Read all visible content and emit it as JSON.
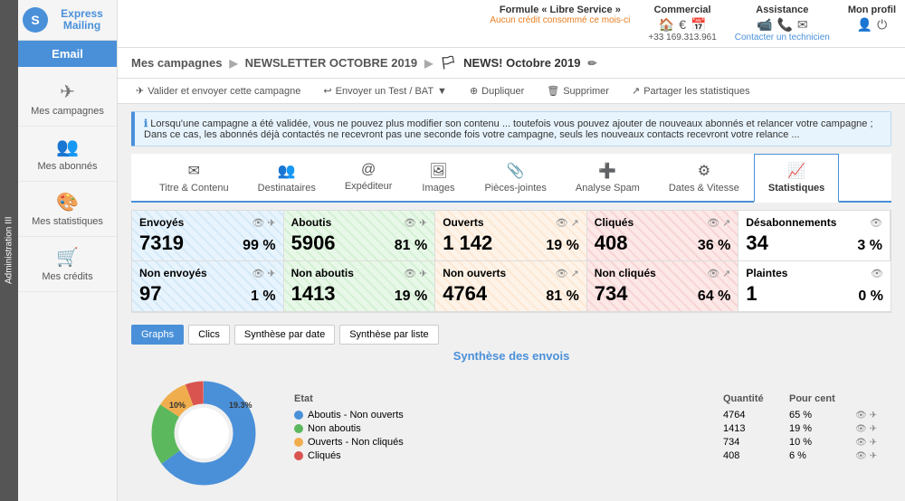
{
  "adminBar": {
    "label": "Administration III"
  },
  "sidebar": {
    "logo": {
      "icon": "S",
      "name": "Express",
      "highlight": "M",
      "suffix": "ailing"
    },
    "emailBtn": "Email",
    "items": [
      {
        "id": "campagnes",
        "label": "Mes campagnes",
        "icon": "✈"
      },
      {
        "id": "abonnes",
        "label": "Mes abonnés",
        "icon": "👥"
      },
      {
        "id": "statistiques",
        "label": "Mes statistiques",
        "icon": "🎨"
      },
      {
        "id": "credits",
        "label": "Mes crédits",
        "icon": "🛒"
      }
    ]
  },
  "header": {
    "formule": {
      "label": "Formule « Libre Service »",
      "link": "Aucun crédit consommé ce mois-ci"
    },
    "commercial": {
      "label": "Commercial",
      "phone": "+33 169.313.961"
    },
    "assistance": {
      "label": "Assistance",
      "link": "Contacter un technicien"
    },
    "profil": {
      "label": "Mon profil"
    }
  },
  "breadcrumb": {
    "items": [
      "Mes campagnes",
      "NEWSLETTER OCTOBRE 2019",
      "NEWS! Octobre 2019"
    ]
  },
  "actions": [
    {
      "id": "valider",
      "label": "Valider et envoyer cette campagne",
      "icon": "✈"
    },
    {
      "id": "test",
      "label": "Envoyer un Test / BAT",
      "icon": "↩",
      "dropdown": true
    },
    {
      "id": "dupliquer",
      "label": "Dupliquer",
      "icon": "⊕"
    },
    {
      "id": "supprimer",
      "label": "Supprimer",
      "icon": "🗑"
    },
    {
      "id": "partager",
      "label": "Partager les statistiques",
      "icon": "↗"
    }
  ],
  "infoBar": {
    "text": "Lorsqu'une campagne a été validée, vous ne pouvez plus modifier son contenu ... toutefois vous pouvez ajouter de nouveaux abonnés et relancer votre campagne ; Dans ce cas, les abonnés déjà contactés ne recevront pas une seconde fois votre campagne, seuls les nouveaux contacts recevront votre relance ..."
  },
  "tabs": [
    {
      "id": "titre",
      "label": "Titre & Contenu",
      "icon": "✉"
    },
    {
      "id": "destinataires",
      "label": "Destinataires",
      "icon": "👥"
    },
    {
      "id": "expediteur",
      "label": "Expéditeur",
      "icon": "@"
    },
    {
      "id": "images",
      "label": "Images",
      "icon": "🖼"
    },
    {
      "id": "pieces",
      "label": "Pièces-jointes",
      "icon": "📎"
    },
    {
      "id": "spam",
      "label": "Analyse Spam",
      "icon": "➕"
    },
    {
      "id": "dates",
      "label": "Dates & Vitesse",
      "icon": "⚙"
    },
    {
      "id": "stats",
      "label": "Statistiques",
      "icon": "📈",
      "active": true
    }
  ],
  "statsGrid": {
    "row1": [
      {
        "id": "envoyes",
        "title": "Envoyés",
        "value": "7319",
        "percent": "99 %",
        "color": "blue"
      },
      {
        "id": "aboutis",
        "title": "Aboutis",
        "value": "5906",
        "percent": "81 %",
        "color": "green"
      },
      {
        "id": "ouverts",
        "title": "Ouverts",
        "value": "1 142",
        "percent": "19 %",
        "color": "orange"
      },
      {
        "id": "cliques",
        "title": "Cliqués",
        "value": "408",
        "percent": "36 %",
        "color": "red"
      },
      {
        "id": "desabo",
        "title": "Désabonnements",
        "value": "34",
        "percent": "3 %",
        "color": "white"
      }
    ],
    "row2": [
      {
        "id": "nonenvoyes",
        "title": "Non envoyés",
        "value": "97",
        "percent": "1 %",
        "color": "blue"
      },
      {
        "id": "nonaboutis",
        "title": "Non aboutis",
        "value": "1413",
        "percent": "19 %",
        "color": "green"
      },
      {
        "id": "nonouverts",
        "title": "Non ouverts",
        "value": "4764",
        "percent": "81 %",
        "color": "orange"
      },
      {
        "id": "noncliques",
        "title": "Non cliqués",
        "value": "734",
        "percent": "64 %",
        "color": "red"
      },
      {
        "id": "plaintes",
        "title": "Plaintes",
        "value": "1",
        "percent": "0 %",
        "color": "white"
      }
    ]
  },
  "subButtons": [
    "Graphs",
    "Clics",
    "Synthèse par date",
    "Synthèse par liste"
  ],
  "synthese": {
    "title": "Synthèse des envois",
    "chartData": [
      {
        "label": "65.1%",
        "color": "#4a90d9",
        "percent": 65.1
      },
      {
        "label": "19.3%",
        "color": "#5cb85c",
        "percent": 19.3
      },
      {
        "label": "10%",
        "color": "#f0ad4e",
        "percent": 10
      },
      {
        "label": "",
        "color": "#d9534f",
        "percent": 5.6
      }
    ],
    "legend": {
      "headers": [
        "Etat",
        "Quantité",
        "Pour cent"
      ],
      "rows": [
        {
          "label": "Aboutis - Non ouverts",
          "color": "#4a90d9",
          "qty": "4764",
          "pct": "65 %"
        },
        {
          "label": "Non aboutis",
          "color": "#5cb85c",
          "qty": "1413",
          "pct": "19 %"
        },
        {
          "label": "Ouverts - Non cliqués",
          "color": "#f0ad4e",
          "qty": "734",
          "pct": "10 %"
        },
        {
          "label": "Cliqués",
          "color": "#d9534f",
          "qty": "408",
          "pct": "6 %"
        }
      ]
    }
  }
}
